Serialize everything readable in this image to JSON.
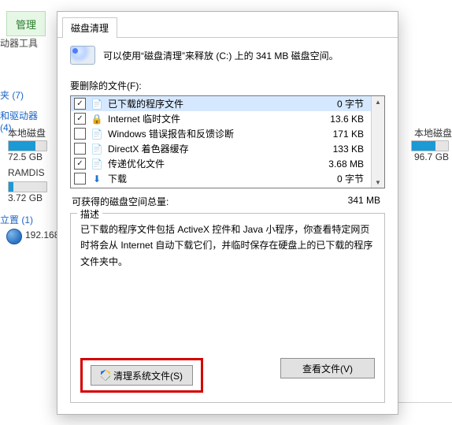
{
  "bg": {
    "tab_manage": "管理",
    "subtab_driver_tools": "动器工具",
    "quick_access_label": "夹 (7)",
    "drives_label": "和驱动器 (4)",
    "drive1_label": "本地磁盘",
    "drive1_size": "72.5 GB",
    "drive2_label": "RAMDIS",
    "drive2_size": "3.72 GB",
    "places_label": "立置 (1)",
    "network_ip": "192.168",
    "right_drive_label": "本地磁盘",
    "right_drive_size": "96.7 GB"
  },
  "dlg": {
    "tab_label": "磁盘清理",
    "info_line": "可以使用“磁盘清理”来释放  (C:) 上的 341 MB 磁盘空间。",
    "files_to_delete_label": "要删除的文件(F):",
    "rows": [
      {
        "name": "已下载的程序文件",
        "size": "0 字节",
        "checked": true,
        "glyph": "📄",
        "sel": true
      },
      {
        "name": "Internet 临时文件",
        "size": "13.6 KB",
        "checked": true,
        "glyph": "🔒",
        "sel": false
      },
      {
        "name": "Windows 错误报告和反馈诊断",
        "size": "171 KB",
        "checked": false,
        "glyph": "📄",
        "sel": false
      },
      {
        "name": "DirectX 着色器缓存",
        "size": "133 KB",
        "checked": false,
        "glyph": "📄",
        "sel": false
      },
      {
        "name": "传递优化文件",
        "size": "3.68 MB",
        "checked": true,
        "glyph": "📄",
        "sel": false
      },
      {
        "name": "下载",
        "size": "0 字节",
        "checked": false,
        "glyph": "⬇",
        "sel": false
      }
    ],
    "total_label": "可获得的磁盘空间总量:",
    "total_value": "341 MB",
    "desc_legend": "描述",
    "desc_text": "已下载的程序文件包括 ActiveX 控件和 Java 小程序，你查看特定网页时将会从 Internet 自动下载它们，并临时保存在硬盘上的已下载的程序文件夹中。",
    "clean_sys_label": "清理系统文件(S)",
    "view_files_label": "查看文件(V)"
  }
}
